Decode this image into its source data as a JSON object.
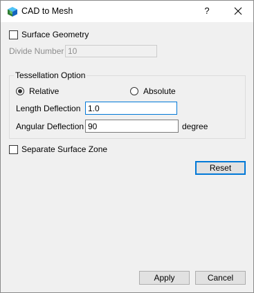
{
  "window": {
    "title": "CAD to Mesh",
    "help_label": "?",
    "app_icon": "cad-mesh-app-icon",
    "close_icon": "close-icon"
  },
  "surface_geometry": {
    "label": "Surface Geometry",
    "checked": false
  },
  "divide_number": {
    "label": "Divide Number",
    "value": "10",
    "enabled": false
  },
  "tessellation": {
    "group_title": "Tessellation Option",
    "mode_options": [
      {
        "label": "Relative",
        "selected": true
      },
      {
        "label": "Absolute",
        "selected": false
      }
    ],
    "length_deflection": {
      "label": "Length Deflection",
      "value": "1.0"
    },
    "angular_deflection": {
      "label": "Angular Deflection",
      "value": "90",
      "unit": "degree"
    }
  },
  "separate_surface_zone": {
    "label": "Separate Surface Zone",
    "checked": false
  },
  "buttons": {
    "reset": "Reset",
    "apply": "Apply",
    "cancel": "Cancel"
  },
  "colors": {
    "focus_border": "#0078d7",
    "dialog_bg": "#f0f0f0",
    "titlebar_bg": "#ffffff"
  }
}
